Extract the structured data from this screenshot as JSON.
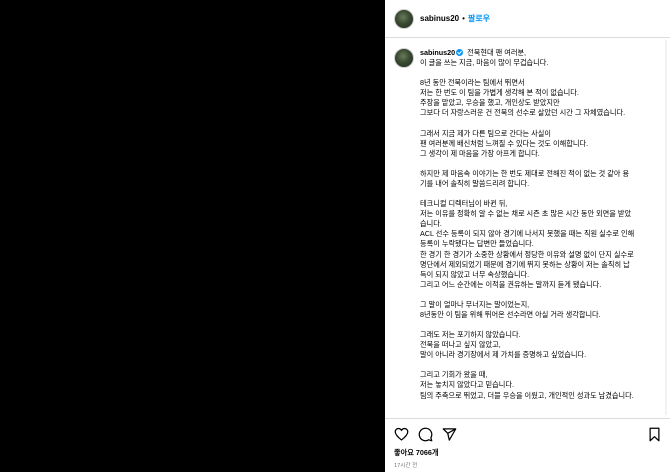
{
  "header": {
    "username": "sabinus20",
    "separator": "•",
    "follow_label": "팔로우"
  },
  "caption": {
    "username": "sabinus20",
    "lines": [
      "전북현대 팬 여러분,",
      "이 글을 쓰는 지금, 마음이 많이 무겁습니다.",
      "",
      "8년 동안 전북이라는 팀에서 뛰면서",
      "저는 한 번도 이 팀을 가볍게 생각해 본 적이 없습니다.",
      "주장을 맡았고, 우승을 했고, 개인상도 받았지만",
      "그보다 더 자랑스러운 건 전북의 선수로 살았던 시간 그 자체였습니다.",
      "",
      "그래서 지금 제가 다른 팀으로 간다는 사실이",
      "팬 여러분께 배신처럼 느껴질 수 있다는 것도 이해합니다.",
      "그 생각이 제 마음을 가장 아프게 합니다.",
      "",
      "하지만 제 마음속 이야기는 한 번도 제대로 전해진 적이 없는 것 같아 용",
      "기를 내어 솔직히 말씀드리려 합니다.",
      "",
      "테크니컬 디렉터님이 바뀐 뒤,",
      "저는 이유를 정확히 알 수 없는 채로 시즌 초 많은 시간 동안 외면을 받았",
      "습니다.",
      "ACL 선수 등록이 되지 않아 경기에 나서지 못했을 때는 직원 실수로 인해",
      "등록이 누락됐다는 답변만 들었습니다.",
      "한 경기 한 경기가 소중한 상황에서 정당한 이유와 설명 없이 단지 실수로",
      "명단에서 제외되었기 때문에 경기에 뛰지 못하는 상황이 저는 솔직히 납",
      "득이 되지 않았고 너무 속상했습니다.",
      "그리고 어느 순간에는 이적을 권유하는 말까지 듣게 됐습니다.",
      "",
      "그 말이 얼마나 무너지는 말이었는지,",
      "8년동안 이 팀을 위해 뛰어온 선수라면 아실 거라 생각합니다.",
      "",
      "그래도 저는 포기하지 않았습니다.",
      "전북을 떠나고 싶지 않았고,",
      "말이 아니라 경기장에서 제 가치를 증명하고 싶었습니다.",
      "",
      "그리고 기회가 왔을 때,",
      "저는 놓치지 않았다고 믿습니다.",
      "팀의 주축으로 뛰었고, 더블 우승을 이뤘고, 개인적인 성과도 남겼습니다."
    ]
  },
  "icons": [
    "heart-icon",
    "comment-icon",
    "share-icon",
    "bookmark-icon"
  ],
  "likes_text": "좋아요 7066개",
  "time_text": "17시간 전"
}
